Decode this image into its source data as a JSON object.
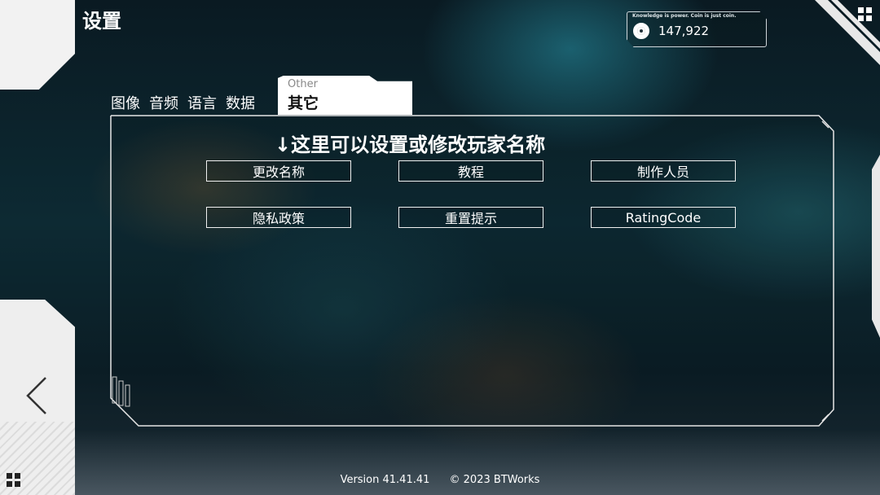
{
  "header": {
    "title": "设置"
  },
  "coins": {
    "tagline": "Knowledge is power. Coin is just coin.",
    "value": "147,922"
  },
  "tabs": [
    {
      "label": "图像"
    },
    {
      "label": "音频"
    },
    {
      "label": "语言"
    },
    {
      "label": "数据"
    }
  ],
  "active_tab": {
    "subtitle": "Other",
    "label": "其它"
  },
  "panel": {
    "hint": "↓这里可以设置或修改玩家名称",
    "buttons": [
      {
        "label": "更改名称"
      },
      {
        "label": "教程"
      },
      {
        "label": "制作人员"
      },
      {
        "label": "隐私政策"
      },
      {
        "label": "重置提示"
      },
      {
        "label": "RatingCode"
      }
    ]
  },
  "footer": {
    "version": "Version 41.41.41",
    "copyright": "© 2023 BTWorks"
  },
  "icons": {
    "back": "chevron-left-icon",
    "menu": "grid-icon",
    "coin": "coin-icon"
  }
}
